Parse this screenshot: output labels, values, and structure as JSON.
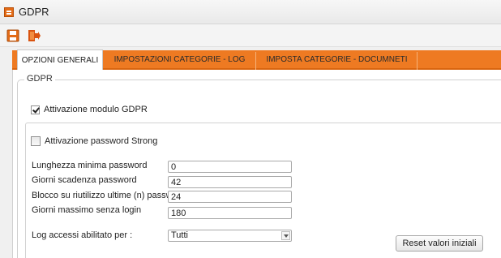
{
  "window": {
    "title": "GDPR"
  },
  "toolbar": {
    "save_icon": "save-icon",
    "exit_icon": "exit-icon"
  },
  "tabs": [
    {
      "label": "OPZIONI GENERALI",
      "active": true
    },
    {
      "label": "IMPOSTAZIONI CATEGORIE - LOG",
      "active": false
    },
    {
      "label": "IMPOSTA CATEGORIE -  DOCUMNETI",
      "active": false
    }
  ],
  "section": {
    "legend": "GDPR"
  },
  "gdpr_module": {
    "label": "Attivazione modulo GDPR",
    "checked": true
  },
  "strong_password": {
    "label": "Attivazione password Strong",
    "checked": false
  },
  "fields": [
    {
      "label": "Lunghezza minima password",
      "value": "0"
    },
    {
      "label": "Giorni scadenza password",
      "value": "42"
    },
    {
      "label": "Blocco su riutilizzo ultime (n) password",
      "value": "24"
    },
    {
      "label": "Giorni massimo senza login",
      "value": "180"
    }
  ],
  "log_access": {
    "label": "Log accessi abilitato per :",
    "selected": "Tutti"
  },
  "reset_button": {
    "label": "Reset valori iniziali"
  },
  "colors": {
    "accent": "#ee7a22",
    "accent_dark": "#d9650f",
    "tab_divider": "#f6b27a"
  }
}
